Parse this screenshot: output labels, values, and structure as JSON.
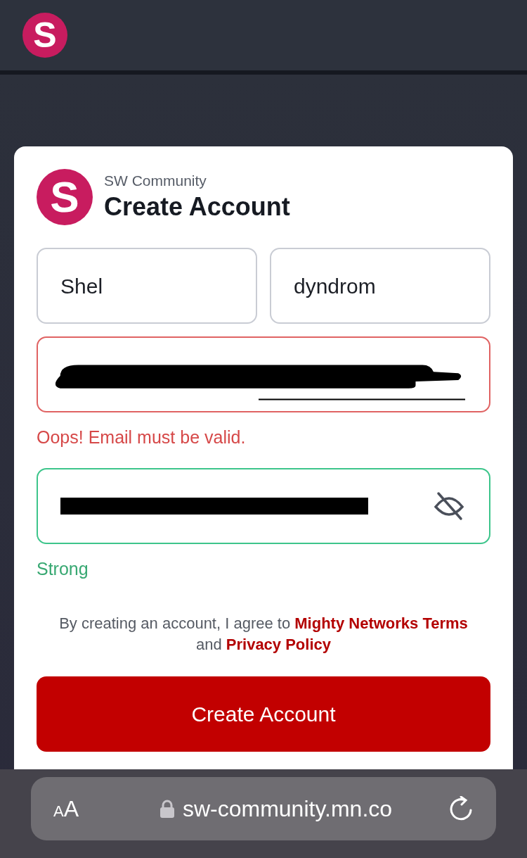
{
  "header": {
    "logo_letter": "S"
  },
  "card": {
    "logo_letter": "S",
    "community": "SW Community",
    "title": "Create Account"
  },
  "fields": [
    {
      "kind": "text",
      "value": "Shel",
      "invalid": false,
      "valid": false
    },
    {
      "kind": "text",
      "value": "dyndrom",
      "invalid": false,
      "valid": false
    },
    {
      "kind": "redacted",
      "invalid": true,
      "valid": false,
      "message": "Oops! Email must be valid."
    },
    {
      "kind": "password",
      "invalid": false,
      "valid": true,
      "message": "Strong"
    }
  ],
  "terms": "By creating an account, I agree to **Mighty Networks Terms** and **Privacy Policy**",
  "submit": "Create Account",
  "browser_bar": {
    "text_size": "AA",
    "url": "sw-community.mn.co"
  }
}
